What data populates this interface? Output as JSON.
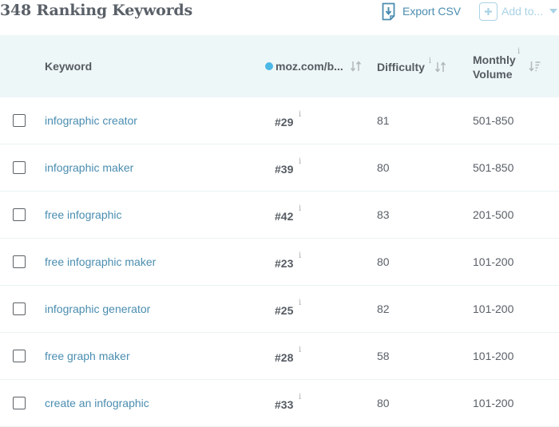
{
  "header": {
    "title": "348 Ranking Keywords",
    "export_label": "Export CSV",
    "add_label": "Add to...",
    "colors": {
      "link": "#4a8db0",
      "muted_accent": "#a9d3e6",
      "header_bg": "#eef7f7",
      "url_dot": "#4cb8e6"
    }
  },
  "columns": {
    "keyword": "Keyword",
    "url": "moz.com/b...",
    "difficulty": "Difficulty",
    "volume_line1": "Monthly",
    "volume_line2": "Volume",
    "info": "i"
  },
  "rows": [
    {
      "keyword": "infographic creator",
      "rank": "#29",
      "difficulty": "81",
      "volume": "501-850"
    },
    {
      "keyword": "infographic maker",
      "rank": "#39",
      "difficulty": "80",
      "volume": "501-850"
    },
    {
      "keyword": "free infographic",
      "rank": "#42",
      "difficulty": "83",
      "volume": "201-500"
    },
    {
      "keyword": "free infographic maker",
      "rank": "#23",
      "difficulty": "80",
      "volume": "101-200"
    },
    {
      "keyword": "infographic generator",
      "rank": "#25",
      "difficulty": "82",
      "volume": "101-200"
    },
    {
      "keyword": "free graph maker",
      "rank": "#28",
      "difficulty": "58",
      "volume": "101-200"
    },
    {
      "keyword": "create an infographic",
      "rank": "#33",
      "difficulty": "80",
      "volume": "101-200"
    }
  ]
}
